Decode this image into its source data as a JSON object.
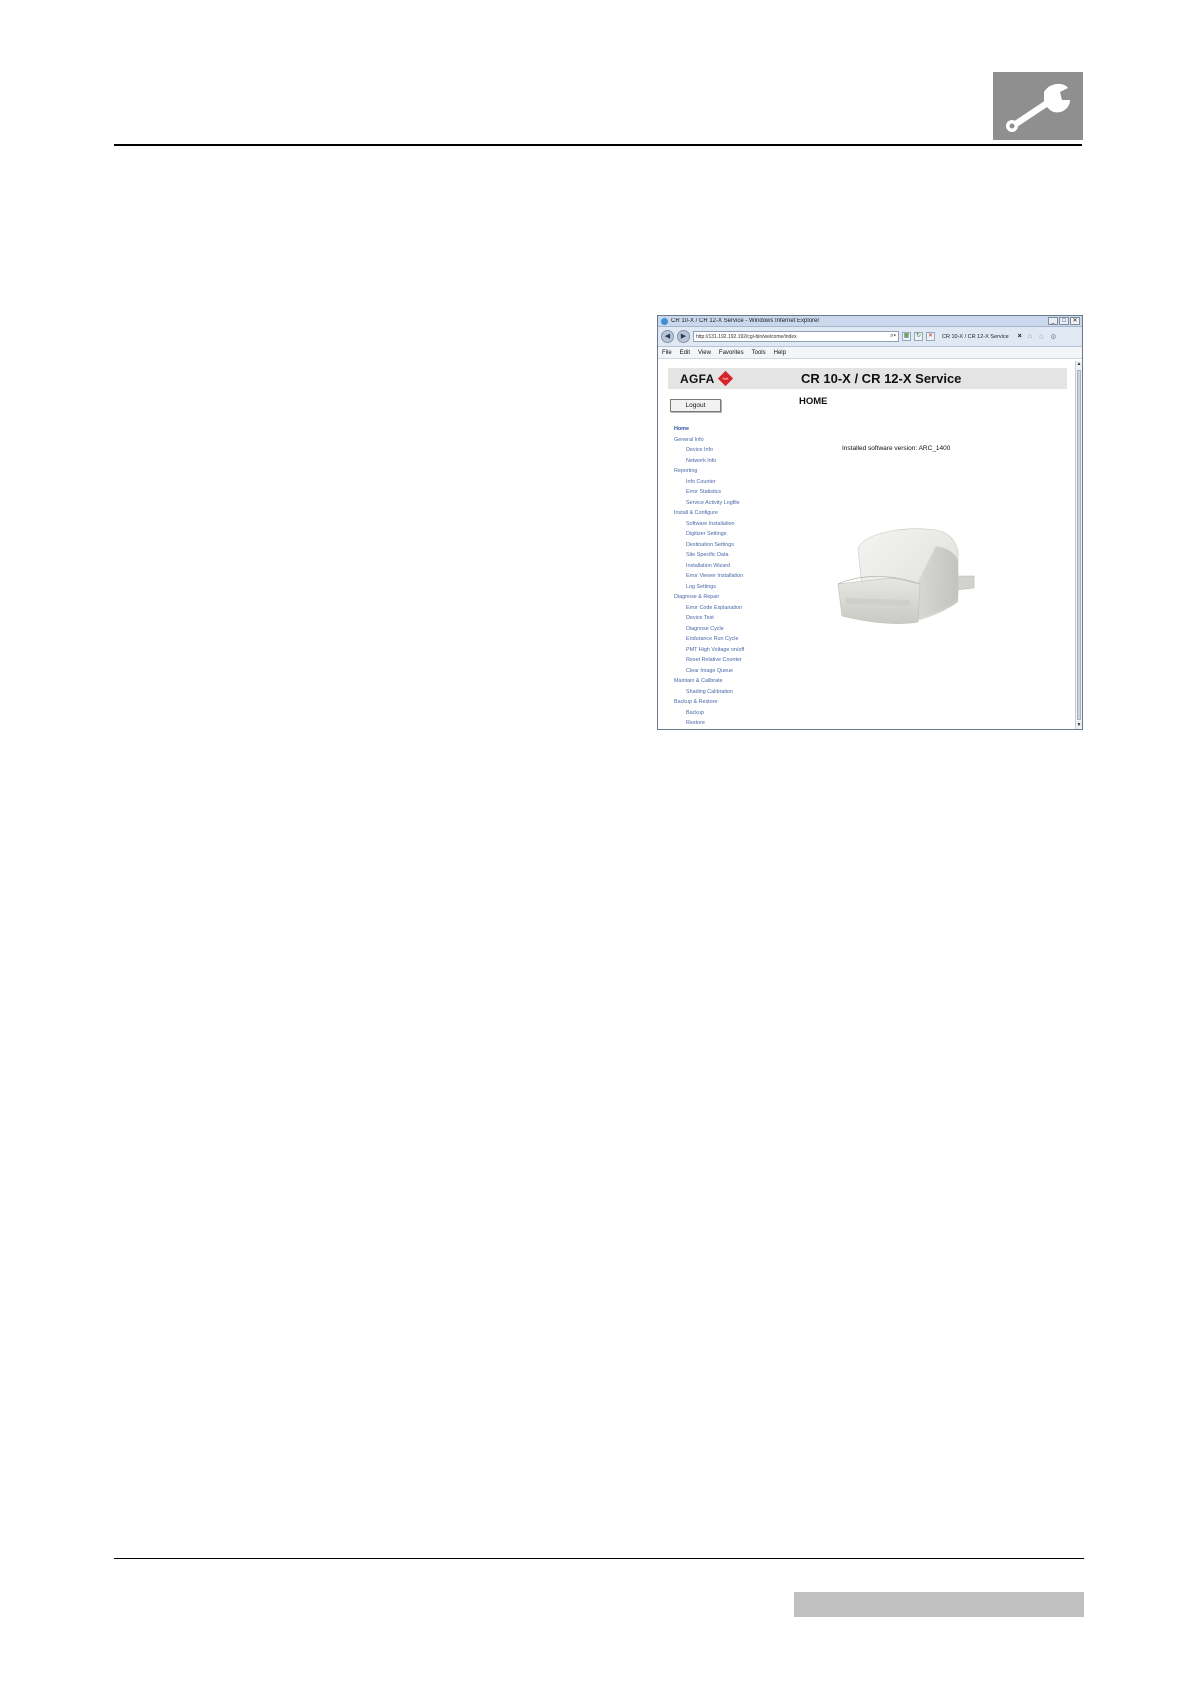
{
  "document": {
    "header_icon": "wrench-icon",
    "colors": {
      "header_icon_bg": "#8f8f8f",
      "footer_box_bg": "#c0c0c0"
    }
  },
  "browser": {
    "window_title": "CR 10-X / CR 12-X Service - Windows Internet Explorer",
    "window_buttons": {
      "minimize": "_",
      "maximize": "□",
      "close": "✕"
    },
    "address_url": "http://131.192.192.192/cgi-bin/welcome/index",
    "tab_label": "CR 10-X / CR 12-X Service",
    "menu": [
      "File",
      "Edit",
      "View",
      "Favorites",
      "Tools",
      "Help"
    ]
  },
  "app": {
    "brand": "AGFA",
    "brand_mark": "Agfa",
    "banner_title": "CR 10-X / CR 12-X Service",
    "page_heading": "HOME",
    "logout_label": "Logout",
    "software_version_text": "Installed software version: ARC_1400",
    "nav": [
      {
        "label": "Home",
        "level": 1,
        "active": true
      },
      {
        "label": "General Info",
        "level": 1
      },
      {
        "label": "Device Info",
        "level": 2
      },
      {
        "label": "Network Info",
        "level": 2
      },
      {
        "label": "Reporting",
        "level": 1
      },
      {
        "label": "Info Counter",
        "level": 2
      },
      {
        "label": "Error Statistics",
        "level": 2
      },
      {
        "label": "Service Activity Logfile",
        "level": 2
      },
      {
        "label": "Install & Configure",
        "level": 1
      },
      {
        "label": "Software Installation",
        "level": 2
      },
      {
        "label": "Digitizer Settings",
        "level": 2
      },
      {
        "label": "Destination Settings",
        "level": 2
      },
      {
        "label": "Site Specific Data",
        "level": 2
      },
      {
        "label": "Installation Wizard",
        "level": 2
      },
      {
        "label": "Error Viewer Installation",
        "level": 2
      },
      {
        "label": "Log Settings",
        "level": 2
      },
      {
        "label": "Diagnose & Repair",
        "level": 1
      },
      {
        "label": "Error Code Explanation",
        "level": 2
      },
      {
        "label": "Device Test",
        "level": 2
      },
      {
        "label": "Diagnose Cycle",
        "level": 2
      },
      {
        "label": "Endurance Run Cycle",
        "level": 2
      },
      {
        "label": "PMT High Voltage on/off",
        "level": 2
      },
      {
        "label": "Reset Relative Counter",
        "level": 2
      },
      {
        "label": "Clear Image Queue",
        "level": 2
      },
      {
        "label": "Maintain & Calibrate",
        "level": 1
      },
      {
        "label": "Shading Calibration",
        "level": 2
      },
      {
        "label": "Backup & Restore",
        "level": 1
      },
      {
        "label": "Backup",
        "level": 2
      },
      {
        "label": "Restore",
        "level": 2
      }
    ],
    "colors": {
      "nav_link": "#4a67a8",
      "brand_red": "#d8232a",
      "banner_bg": "#e4e4e4"
    }
  }
}
